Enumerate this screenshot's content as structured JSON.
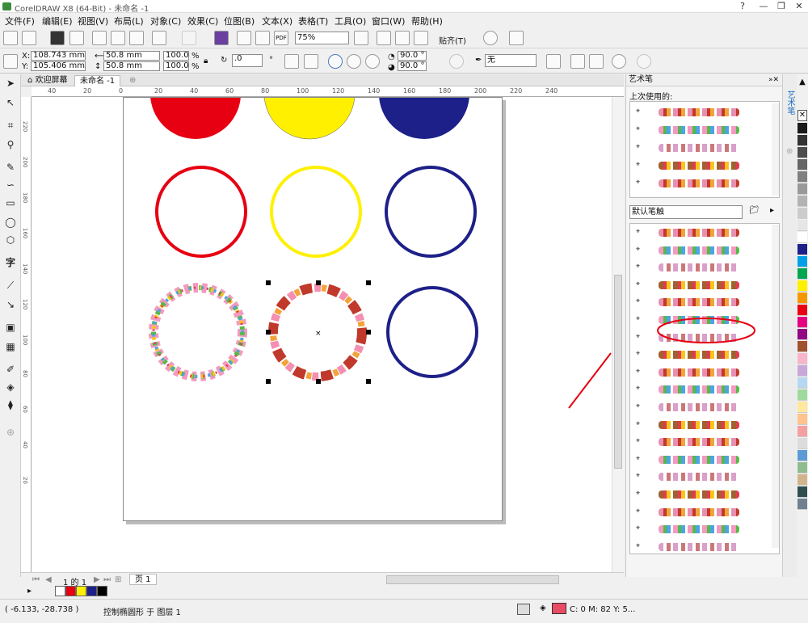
{
  "app": {
    "title": "CorelDRAW X8 (64-Bit) - 未命名 -1"
  },
  "window_buttons": [
    "?",
    "—",
    "❐",
    "✕"
  ],
  "menu": [
    "文件(F)",
    "编辑(E)",
    "视图(V)",
    "布局(L)",
    "对象(C)",
    "效果(C)",
    "位图(B)",
    "文本(X)",
    "表格(T)",
    "工具(O)",
    "窗口(W)",
    "帮助(H)"
  ],
  "toolbar1": {
    "zoom": "75%",
    "snap_label": "贴齐(T)"
  },
  "toolbar2": {
    "x_label": "X:",
    "x_value": "108.743 mm",
    "y_label": "Y:",
    "y_value": "105.406 mm",
    "w_value": "50.8 mm",
    "h_value": "50.8 mm",
    "scale_w": "100.0",
    "scale_h": "100.0",
    "pct": "%",
    "rotation": ".0",
    "rot_unit": "°",
    "angle1": "90.0 °",
    "angle2": "90.0 °",
    "outline": "无"
  },
  "tabs": {
    "welcome": "欢迎屏幕",
    "doc": "未命名 -1"
  },
  "hruler": {
    "labels": [
      "40",
      "20",
      "0",
      "20",
      "40",
      "60",
      "80",
      "100",
      "120",
      "140",
      "160",
      "180",
      "200",
      "220",
      "240"
    ]
  },
  "vruler": {
    "labels": [
      "220",
      "200",
      "180",
      "160",
      "140",
      "120",
      "100",
      "80",
      "60",
      "40",
      "20"
    ]
  },
  "page_nav": {
    "page_of": "1 的 1",
    "page_tab": "页 1"
  },
  "docker": {
    "title": "艺术笔",
    "recent_label": "上次使用的:",
    "category": "默认笔触",
    "side_tab": "艺术笔"
  },
  "statusbar": {
    "coords": "( -6.133, -28.738 )",
    "info": "控制椭圆形 于 图层 1",
    "color_info": "C: 0 M: 82 Y: 5..."
  },
  "colors": {
    "red": "#e60012",
    "yellow": "#fff000",
    "blue": "#1d2088",
    "accent": "#e94b63",
    "highlight": "#00a0e9"
  },
  "palette_bottom": [
    "#ffffff",
    "#e60012",
    "#fff000",
    "#1d2088",
    "#000000"
  ],
  "palette_right": [
    "#1a1a1a",
    "#333333",
    "#4d4d4d",
    "#666666",
    "#808080",
    "#999999",
    "#b3b3b3",
    "#cccccc",
    "#e6e6e6",
    "#ffffff",
    "#1d2088",
    "#00a0e9",
    "#00a651",
    "#fff000",
    "#f39800",
    "#e60012",
    "#e4007f",
    "#920783",
    "#a0522d",
    "#f8b4c8",
    "#c8a8d8",
    "#b7d7f0",
    "#9ed99e",
    "#ffe79e",
    "#ffc38e",
    "#f5a0a0",
    "#dcdcdc",
    "#5b9bd5",
    "#8fbc8f",
    "#d2b48c",
    "#2f4f4f",
    "#708090"
  ]
}
